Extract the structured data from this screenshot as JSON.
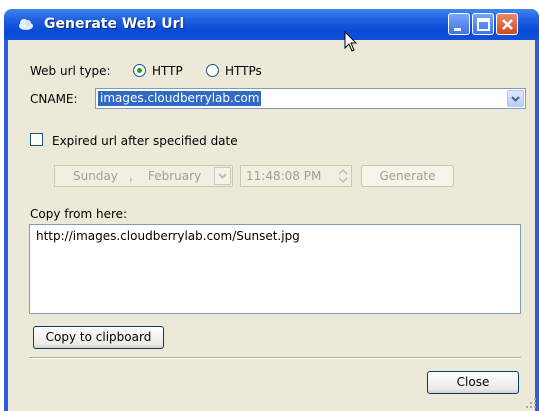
{
  "window": {
    "title": "Generate Web Url"
  },
  "url_type": {
    "label": "Web url type:",
    "options": [
      "HTTP",
      "HTTPs"
    ],
    "selected": "HTTP"
  },
  "cname": {
    "label": "CNAME:",
    "value": "images.cloudberrylab.com"
  },
  "expired": {
    "label": "Expired url after specified date",
    "checked": false,
    "day": "Sunday",
    "month": "February",
    "time": "11:48:08 PM",
    "generate_label": "Generate"
  },
  "copy": {
    "label": "Copy from here:",
    "url": "http://images.cloudberrylab.com/Sunset.jpg",
    "clipboard_button": "Copy to clipboard"
  },
  "footer": {
    "close_label": "Close"
  },
  "colors": {
    "titlebar": "#0a4bd6",
    "client": "#ece9d8",
    "selection": "#316ac5"
  }
}
